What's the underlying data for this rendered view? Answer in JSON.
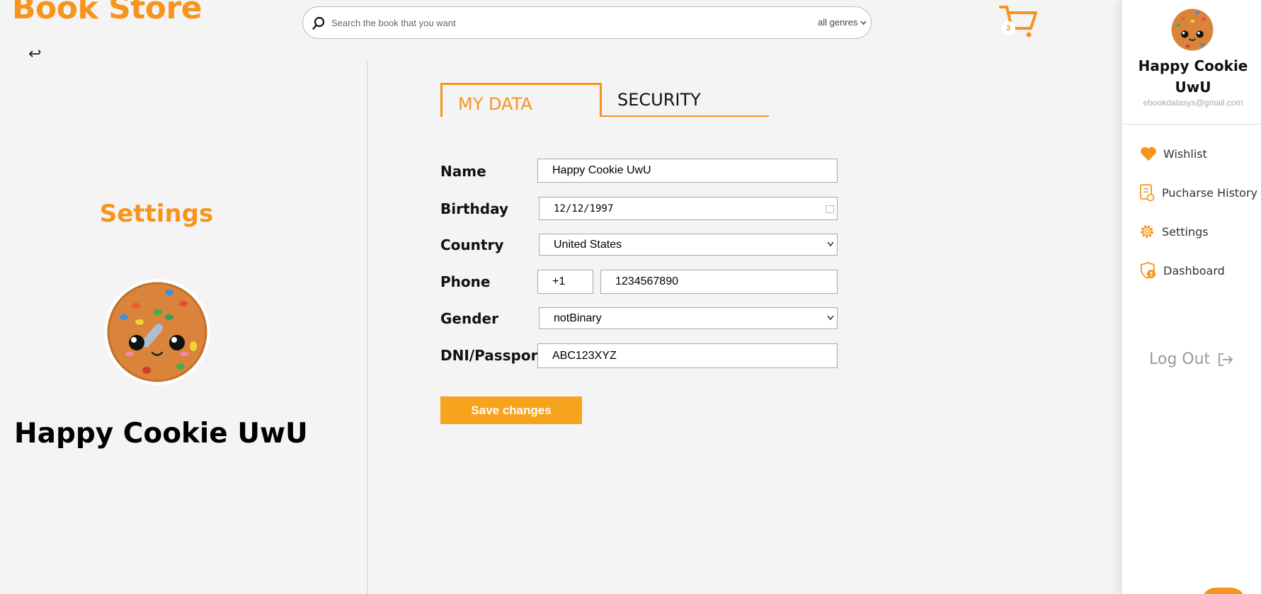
{
  "brand": "Book Store",
  "back_glyph": "↩",
  "search": {
    "placeholder": "Search the book that you want",
    "genre_select": "all genres"
  },
  "cart": {
    "count": "3"
  },
  "left_panel": {
    "title": "Settings",
    "user_name": "Happy Cookie UwU"
  },
  "tabs": [
    {
      "label": "MY DATA",
      "active": true
    },
    {
      "label": "SECURITY",
      "active": false
    }
  ],
  "form": {
    "name": {
      "label": "Name",
      "value": "Happy Cookie UwU"
    },
    "birthday": {
      "label": "Birthday",
      "value": "12/12/1997"
    },
    "country": {
      "label": "Country",
      "value": "United States"
    },
    "phone": {
      "label": "Phone",
      "code": "+1",
      "number": "1234567890"
    },
    "gender": {
      "label": "Gender",
      "value": "notBinary"
    },
    "dni": {
      "label": "DNI/Passport",
      "value": "ABC123XYZ"
    },
    "save_label": "Save changes"
  },
  "drawer": {
    "user_name": "Happy Cookie UwU",
    "email": "ebookdatasys@gmail.com",
    "items": [
      {
        "label": "Wishlist",
        "icon": "heart-icon"
      },
      {
        "label": "Pucharse History",
        "icon": "receipt-icon"
      },
      {
        "label": "Settings",
        "icon": "gear-icon"
      },
      {
        "label": "Dashboard",
        "icon": "shield-user-icon"
      }
    ],
    "logout_label": "Log Out"
  },
  "colors": {
    "accent": "#f7941d",
    "background": "#f4f4f4"
  }
}
